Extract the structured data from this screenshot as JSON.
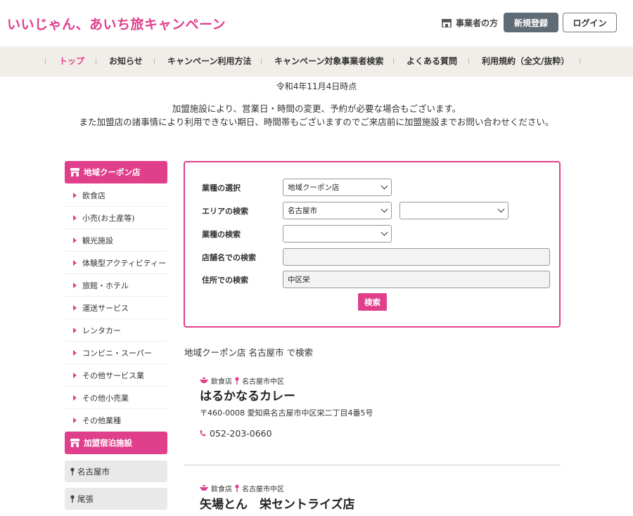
{
  "header": {
    "logo": "いいじゃん、あいち旅キャンペーン",
    "biz_link": "事業者の方",
    "register": "新規登録",
    "login": "ログイン"
  },
  "nav": {
    "items": [
      {
        "label": "トップ"
      },
      {
        "label": "お知らせ"
      },
      {
        "label": "キャンペーン利用方法"
      },
      {
        "label": "キャンペーン対象事業者検索"
      },
      {
        "label": "よくある質問"
      },
      {
        "label": "利用規約（全文/抜粋）"
      }
    ]
  },
  "date_line": "令和4年11月4日時点",
  "notice": {
    "line1": "加盟施設により、営業日・時間の変更、予約が必要な場合もございます。",
    "line2": "また加盟店の諸事情により利用できない期日、時間帯もございますのでご来店前に加盟施設までお問い合わせください。"
  },
  "sidebar": {
    "coupon_head": "地域クーポン店",
    "categories": [
      "飲食店",
      "小売(お土産等)",
      "観光施設",
      "体験型アクティビティー",
      "旅館・ホテル",
      "運送サービス",
      "レンタカー",
      "コンビニ・スーパー",
      "その他サービス業",
      "その他小売業",
      "その他業種"
    ],
    "lodging_head": "加盟宿泊施設",
    "areas": [
      "名古屋市",
      "尾張"
    ]
  },
  "search": {
    "type_label": "業種の選択",
    "type_value": "地域クーポン店",
    "area_label": "エリアの検索",
    "area_value": "名古屋市",
    "area2_value": "",
    "industry_label": "業種の検索",
    "industry_value": "",
    "name_label": "店舗名での検索",
    "name_value": "",
    "address_label": "住所での検索",
    "address_value": "中区栄",
    "button": "検索"
  },
  "results": {
    "title": "地域クーポン店 名古屋市 で検索",
    "items": [
      {
        "category": "飲食店",
        "area": "名古屋市中区",
        "name": "はるかなるカレー",
        "address": "〒460-0008 愛知県名古屋市中区栄二丁目4番5号",
        "tel": "052-203-0660"
      },
      {
        "category": "飲食店",
        "area": "名古屋市中区",
        "name": "矢場とん　栄セントライズ店"
      }
    ]
  },
  "colors": {
    "accent": "#e03f8c",
    "nav_bg": "#f1eeea",
    "register_bg": "#5f6b75"
  }
}
